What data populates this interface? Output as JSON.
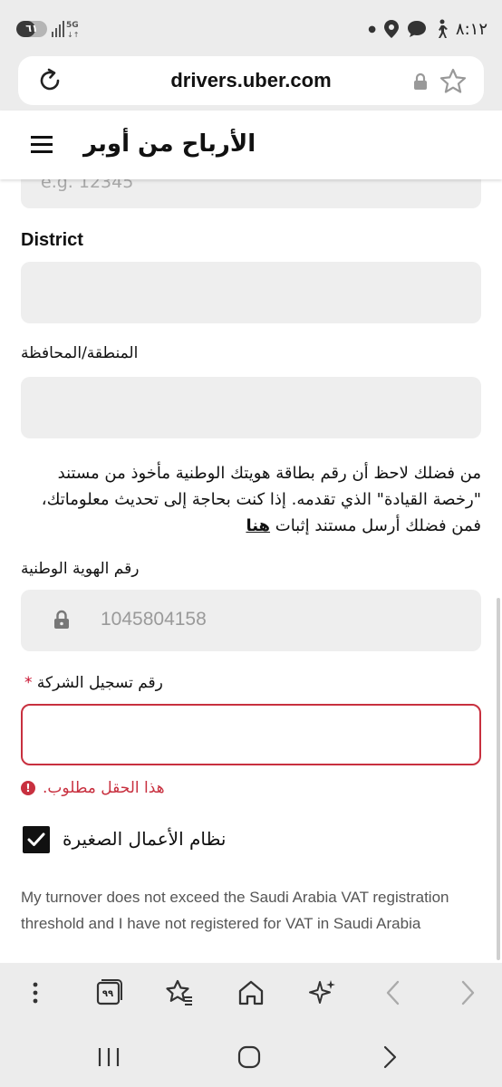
{
  "status_bar": {
    "time": "٨:١٢",
    "battery": "٦١",
    "battery_level": 0.61,
    "network": "5G"
  },
  "browser": {
    "url": "drivers.uber.com",
    "tab_count": "٩٩"
  },
  "site": {
    "title": "الأرباح من أوبر"
  },
  "form": {
    "previous_placeholder": "e.g. 12345",
    "district_label": "District",
    "region_label": "المنطقة/المحافظة",
    "note_text": "من فضلك لاحظ أن رقم بطاقة هويتك الوطنية مأخوذ من مستند \"رخصة القيادة\" الذي تقدمه. إذا كنت بحاجة إلى تحديث معلوماتك، فمن فضلك أرسل مستند إثبات ",
    "note_link": "هنا",
    "national_id_label": "رقم الهوية الوطنية",
    "national_id_value": "1045804158",
    "company_reg_label": "رقم تسجيل الشركة",
    "required_mark": "*",
    "error_text": ".هذا الحقل مطلوب",
    "error_icon": "!",
    "small_business_label": "نظام الأعمال الصغيرة",
    "small_business_checked": true,
    "vat_text": "My turnover does not exceed the Saudi Arabia VAT registration threshold and I have not registered for VAT in Saudi Arabia"
  },
  "colors": {
    "error": "#c8303f",
    "field_bg": "#eeeeee",
    "chrome_bg": "#ececec"
  }
}
